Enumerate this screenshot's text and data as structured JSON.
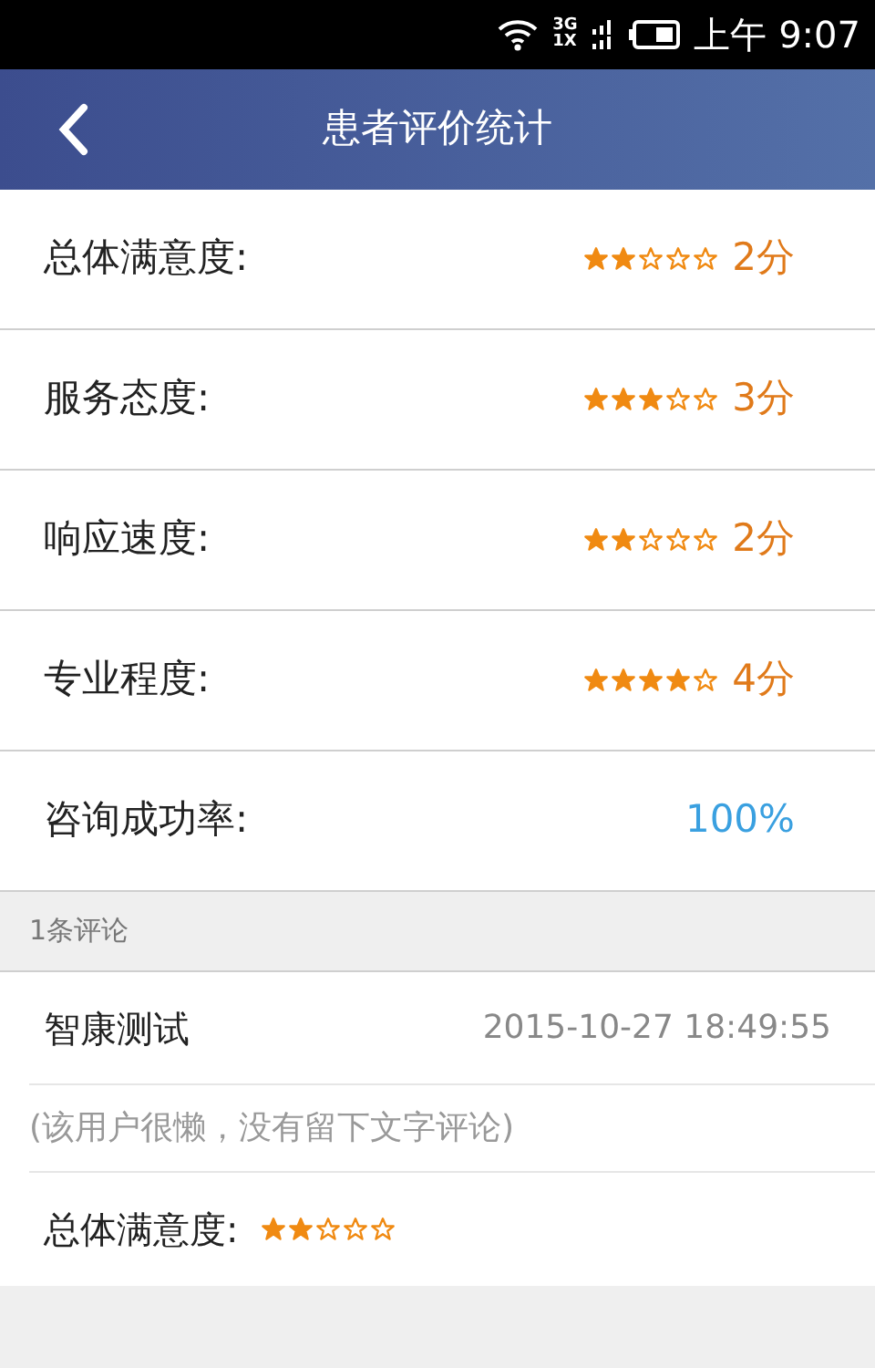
{
  "status_bar": {
    "network": "3G",
    "network2": "1X",
    "time": "上午 9:07"
  },
  "header": {
    "title": "患者评价统计"
  },
  "ratings": [
    {
      "kind": "stars",
      "label": "总体满意度:",
      "stars": 2,
      "score": "2分"
    },
    {
      "kind": "stars",
      "label": "服务态度:",
      "stars": 3,
      "score": "3分"
    },
    {
      "kind": "stars",
      "label": "响应速度:",
      "stars": 2,
      "score": "2分"
    },
    {
      "kind": "stars",
      "label": "专业程度:",
      "stars": 4,
      "score": "4分"
    },
    {
      "kind": "percent",
      "label": "咨询成功率:",
      "score": "100%"
    }
  ],
  "comments_header": "1条评论",
  "comments": [
    {
      "user": "智康测试",
      "time": "2015-10-27 18:49:55",
      "text": "(该用户很懒，没有留下文字评论)",
      "rating_label": "总体满意度:",
      "stars": 2
    }
  ]
}
